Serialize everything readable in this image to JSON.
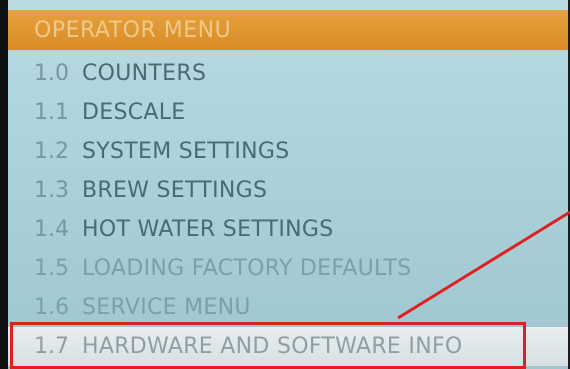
{
  "header": {
    "title": "OPERATOR MENU"
  },
  "menu": {
    "items": [
      {
        "number": "1.0",
        "label": "COUNTERS"
      },
      {
        "number": "1.1",
        "label": "DESCALE"
      },
      {
        "number": "1.2",
        "label": "SYSTEM SETTINGS"
      },
      {
        "number": "1.3",
        "label": "BREW SETTINGS"
      },
      {
        "number": "1.4",
        "label": "HOT WATER SETTINGS"
      },
      {
        "number": "1.5",
        "label": "LOADING FACTORY DEFAULTS"
      },
      {
        "number": "1.6",
        "label": "SERVICE MENU"
      },
      {
        "number": "1.7",
        "label": "HARDWARE AND SOFTWARE INFO"
      }
    ],
    "selected_index": 7
  },
  "annotation": {
    "color": "#e02020"
  },
  "colors": {
    "header": "#e09530",
    "screen": "#b2d5dd",
    "selected": "#e2e9eb"
  }
}
